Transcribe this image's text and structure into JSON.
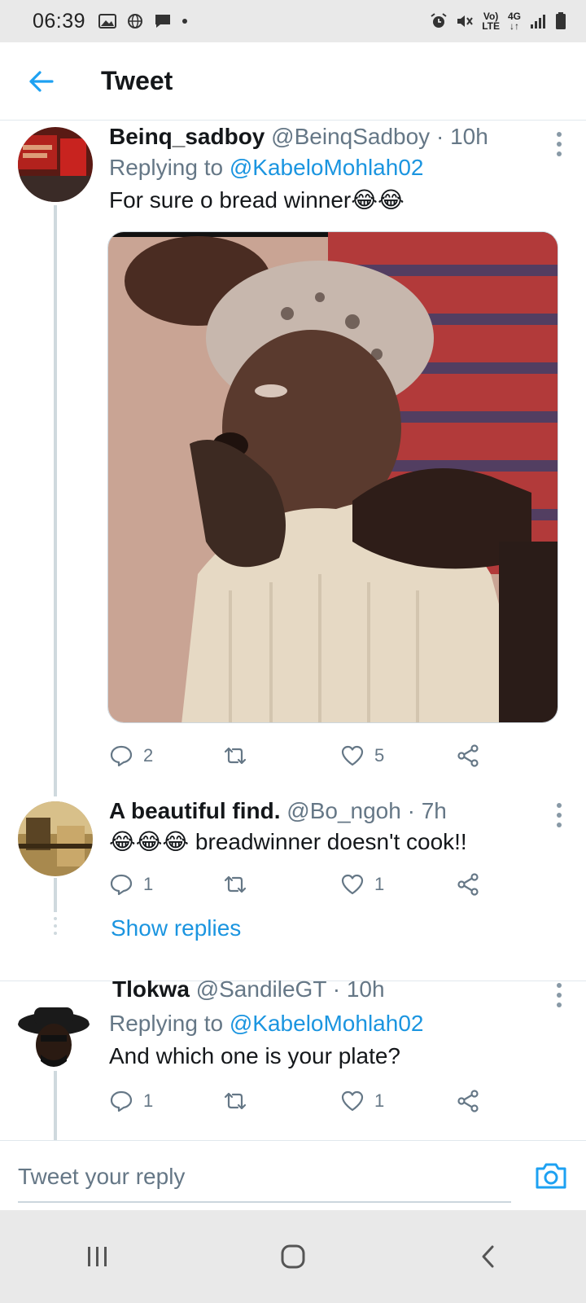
{
  "status_bar": {
    "time": "06:39",
    "network_top": "Vo)",
    "network_bottom": "LTE",
    "data_type_top": "4G",
    "data_type_bottom": "↓↑"
  },
  "header": {
    "title": "Tweet",
    "back_icon": "arrow-left-icon",
    "accent_color": "#1da1f2"
  },
  "tweets": [
    {
      "name": "Beinq_sadboy",
      "handle": "@BeinqSadboy",
      "separator": "·",
      "time_ago": "10h",
      "replying_prefix": "Replying to",
      "replying_to": "@KabeloMohlah02",
      "text": "For sure o bread winner😂😂",
      "has_media": true,
      "replies": "2",
      "retweets": "",
      "likes": "5"
    },
    {
      "name": "A beautiful find.",
      "handle": "@Bo_ngoh",
      "separator": "·",
      "time_ago": "7h",
      "text": "😂😂😂 breadwinner doesn't cook!!",
      "replies": "1",
      "retweets": "",
      "likes": "1",
      "show_replies": "Show replies"
    },
    {
      "name": "Tlokwa",
      "handle": "@SandileGT",
      "separator": "·",
      "time_ago": "10h",
      "replying_prefix": "Replying to",
      "replying_to": "@KabeloMohlah02",
      "text": "And which one is your plate?",
      "replies": "1",
      "retweets": "",
      "likes": "1"
    }
  ],
  "reply_box": {
    "placeholder": "Tweet your reply",
    "camera_icon": "camera-icon"
  },
  "nav_bar": {
    "icons": [
      "recent-apps-icon",
      "home-icon",
      "back-icon"
    ]
  }
}
